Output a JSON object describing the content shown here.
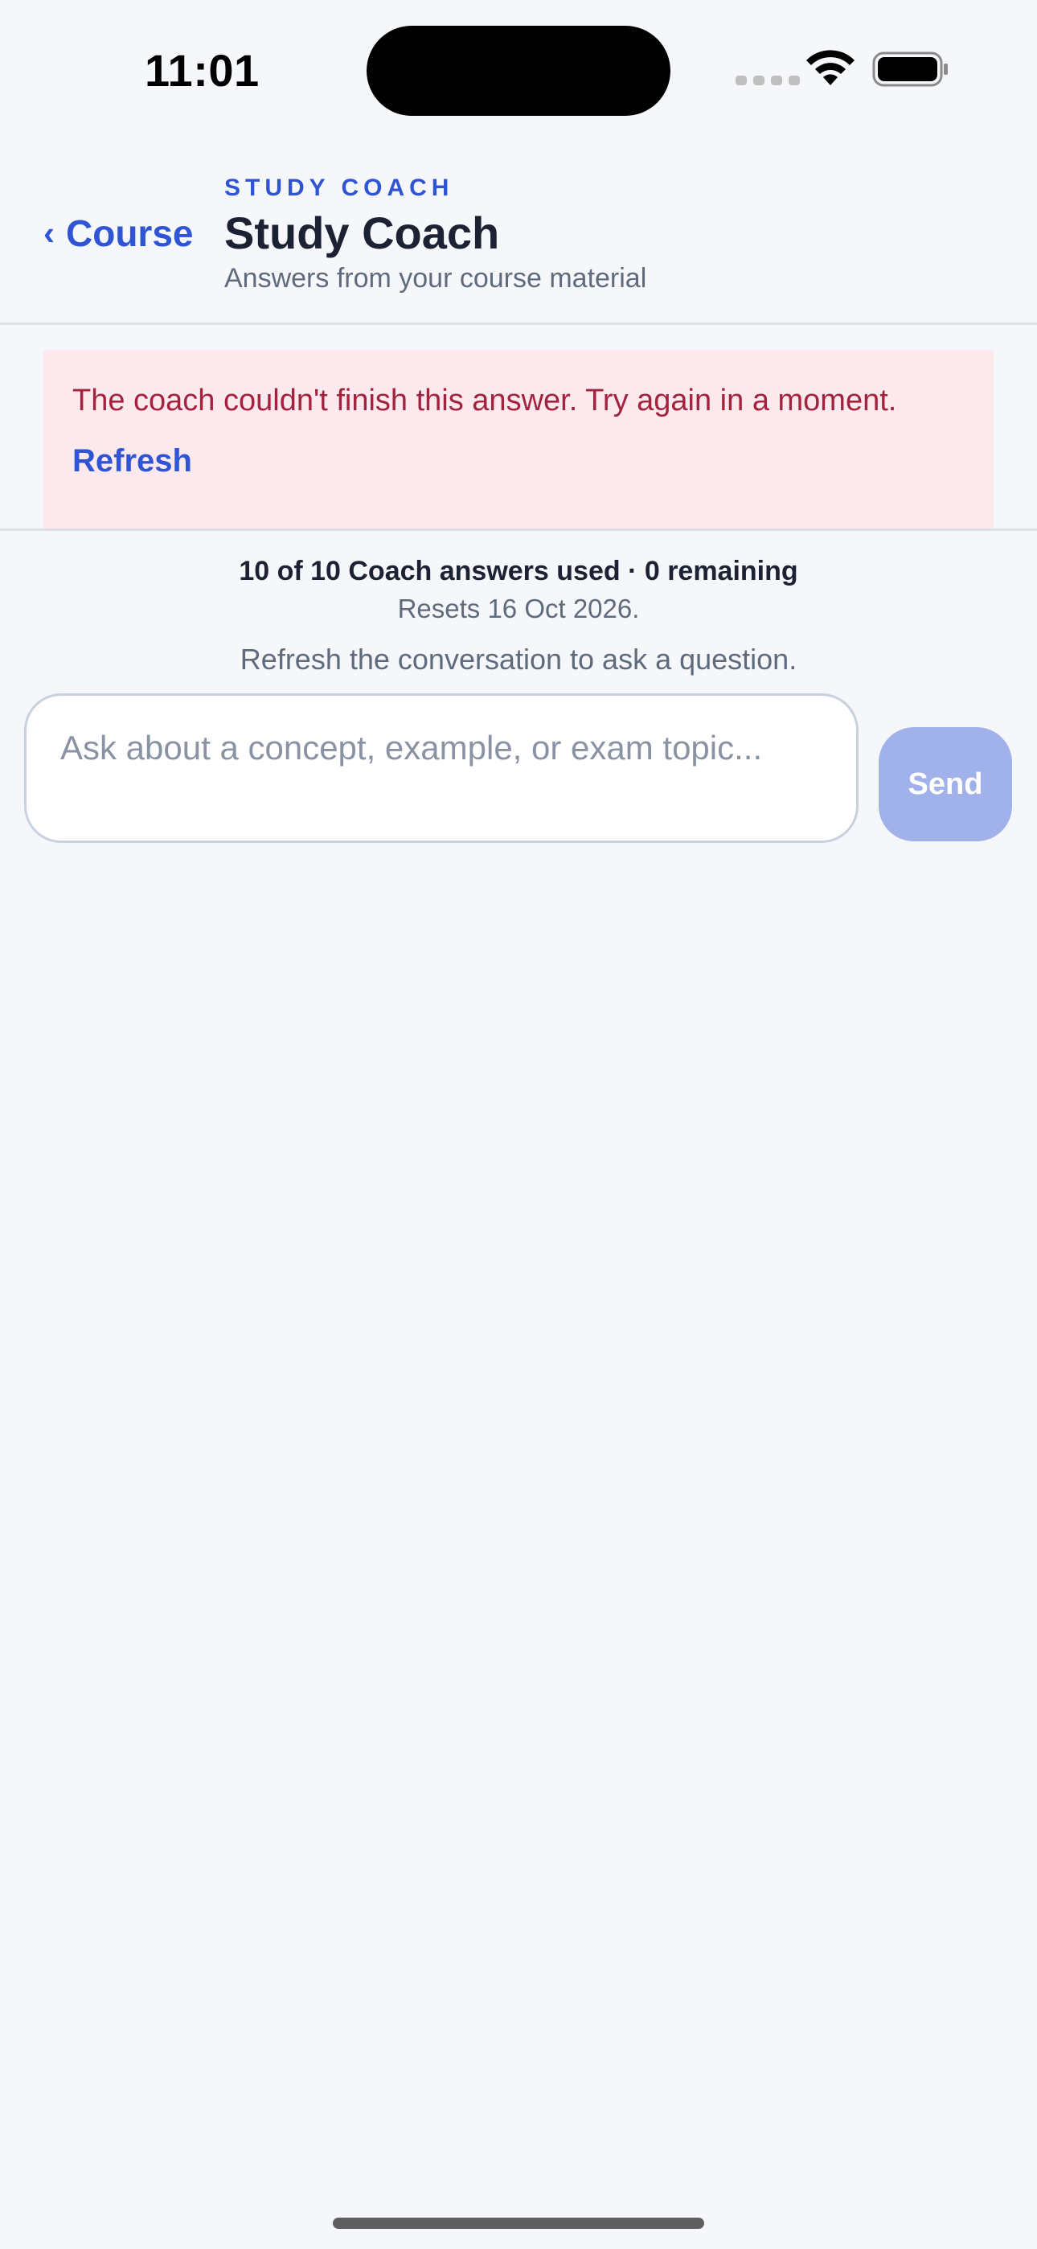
{
  "status_bar": {
    "time": "11:01",
    "wifi_icon": "wifi-icon",
    "battery_icon": "battery-icon",
    "signal_icon": "cellular-signal-icon"
  },
  "header": {
    "back_label": "Course",
    "back_icon": "chevron-left-icon",
    "eyebrow": "STUDY COACH",
    "title": "Study Coach",
    "subtitle": "Answers from your course material"
  },
  "error": {
    "message": "The coach couldn't finish this answer. Try again in a moment.",
    "refresh_label": "Refresh"
  },
  "quota": {
    "usage": "10 of 10 Coach answers used · 0 remaining",
    "reset": "Resets 16 Oct 2026.",
    "hint": "Refresh the conversation to ask a question."
  },
  "composer": {
    "placeholder": "Ask about a concept, example, or exam topic...",
    "send_label": "Send"
  },
  "colors": {
    "accent": "#2f55d4",
    "error_text": "#a3223d",
    "error_background": "#fce9ee",
    "send_disabled": "#a1b2eb",
    "background": "#f5f7fa"
  }
}
